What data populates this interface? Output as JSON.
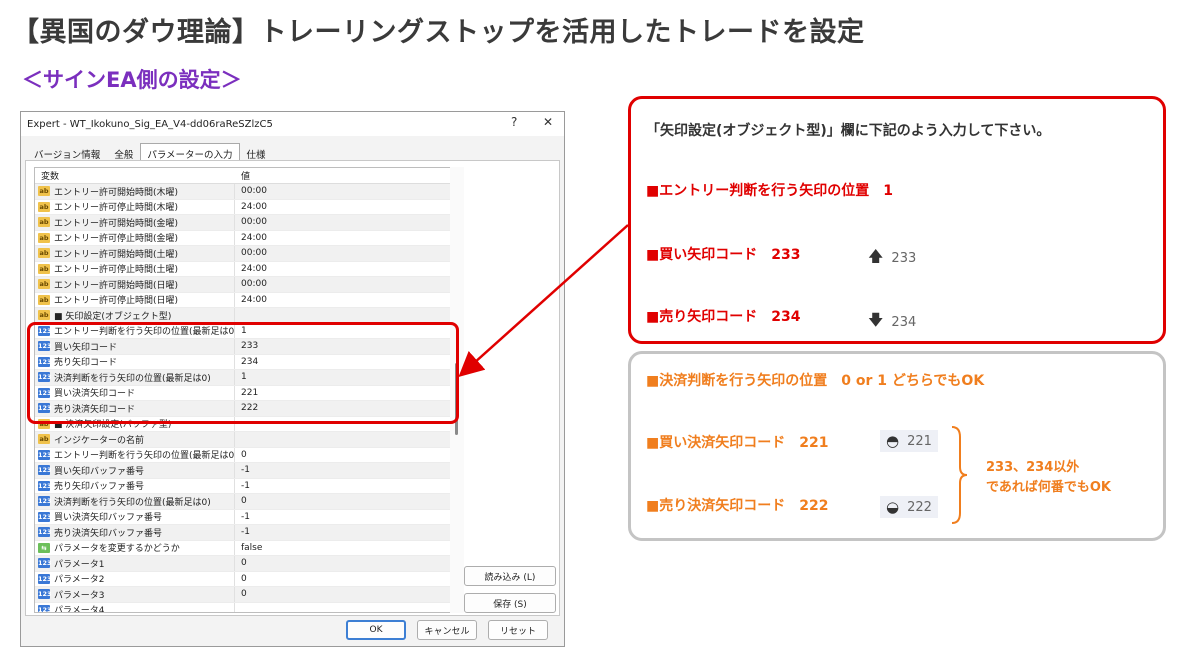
{
  "title": "【異国のダウ理論】トレーリングストップを活用したトレードを設定",
  "subtitle": "＜サインEA側の設定＞",
  "dialog": {
    "window_title": "Expert - WT_Ikokuno_Sig_EA_V4-dd06raReSZlzC5",
    "help_label": "?",
    "close_label": "✕",
    "tabs": [
      "バージョン情報",
      "全般",
      "パラメーターの入力",
      "仕様"
    ],
    "columns": [
      "変数",
      "値"
    ],
    "rows": [
      {
        "name": "エントリー許可開始時間(木曜)",
        "value": "00:00",
        "icon": "ab"
      },
      {
        "name": "エントリー許可停止時間(木曜)",
        "value": "24:00",
        "icon": "ab"
      },
      {
        "name": "エントリー許可開始時間(金曜)",
        "value": "00:00",
        "icon": "ab"
      },
      {
        "name": "エントリー許可停止時間(金曜)",
        "value": "24:00",
        "icon": "ab"
      },
      {
        "name": "エントリー許可開始時間(土曜)",
        "value": "00:00",
        "icon": "ab"
      },
      {
        "name": "エントリー許可停止時間(土曜)",
        "value": "24:00",
        "icon": "ab"
      },
      {
        "name": "エントリー許可開始時間(日曜)",
        "value": "00:00",
        "icon": "ab"
      },
      {
        "name": "エントリー許可停止時間(日曜)",
        "value": "24:00",
        "icon": "ab"
      },
      {
        "name": "■ 矢印設定(オブジェクト型)",
        "value": "",
        "icon": "ab"
      },
      {
        "name": "エントリー判断を行う矢印の位置(最新足は0)",
        "value": "1",
        "icon": "num"
      },
      {
        "name": "買い矢印コード",
        "value": "233",
        "icon": "num"
      },
      {
        "name": "売り矢印コード",
        "value": "234",
        "icon": "num"
      },
      {
        "name": "決済判断を行う矢印の位置(最新足は0)",
        "value": "1",
        "icon": "num"
      },
      {
        "name": "買い決済矢印コード",
        "value": "221",
        "icon": "num"
      },
      {
        "name": "売り決済矢印コード",
        "value": "222",
        "icon": "num"
      },
      {
        "name": "■ 決済矢印設定(バッファ型)",
        "value": "",
        "icon": "ab"
      },
      {
        "name": "インジケーターの名前",
        "value": "",
        "icon": "ab"
      },
      {
        "name": "エントリー判断を行う矢印の位置(最新足は0)",
        "value": "0",
        "icon": "num"
      },
      {
        "name": "買い矢印バッファ番号",
        "value": "-1",
        "icon": "num"
      },
      {
        "name": "売り矢印バッファ番号",
        "value": "-1",
        "icon": "num"
      },
      {
        "name": "決済判断を行う矢印の位置(最新足は0)",
        "value": "0",
        "icon": "num"
      },
      {
        "name": "買い決済矢印バッファ番号",
        "value": "-1",
        "icon": "num"
      },
      {
        "name": "売り決済矢印バッファ番号",
        "value": "-1",
        "icon": "num"
      },
      {
        "name": "パラメータを変更するかどうか",
        "value": "false",
        "icon": "bool"
      },
      {
        "name": "パラメータ1",
        "value": "0",
        "icon": "num"
      },
      {
        "name": "パラメータ2",
        "value": "0",
        "icon": "num"
      },
      {
        "name": "パラメータ3",
        "value": "0",
        "icon": "num"
      },
      {
        "name": "パラメータ4",
        "value": "",
        "icon": "num"
      }
    ],
    "load_label": "読み込み (L)",
    "save_label": "保存 (S)",
    "ok_label": "OK",
    "cancel_label": "キャンセル",
    "reset_label": "リセット"
  },
  "callout_red": {
    "heading": "「矢印設定(オブジェクト型)」欄に下記のよう入力して下さい。",
    "line1": "■エントリー判断を行う矢印の位置　1",
    "line2": "■買い矢印コード　233",
    "line2_sample": "233",
    "line3": "■売り矢印コード　234",
    "line3_sample": "234"
  },
  "callout_gray": {
    "line1": "■決済判断を行う矢印の位置　0 or 1 どちらでもOK",
    "line2": "■買い決済矢印コード　221",
    "line2_sample": "221",
    "line3": "■売り決済矢印コード　222",
    "line3_sample": "222",
    "note_line1": "233、234以外",
    "note_line2": "であれば何番でもOK"
  },
  "colors": {
    "accent_red": "#e00000",
    "accent_orange": "#f07e1e",
    "subtitle_purple": "#7b2fbe",
    "frame_gray": "#c4c4c4"
  },
  "icons": {
    "buy_arrow": "arrow-up-icon",
    "sell_arrow": "arrow-down-icon",
    "buy_exit": "buy-exit-arrow-icon",
    "sell_exit": "sell-exit-arrow-icon"
  }
}
